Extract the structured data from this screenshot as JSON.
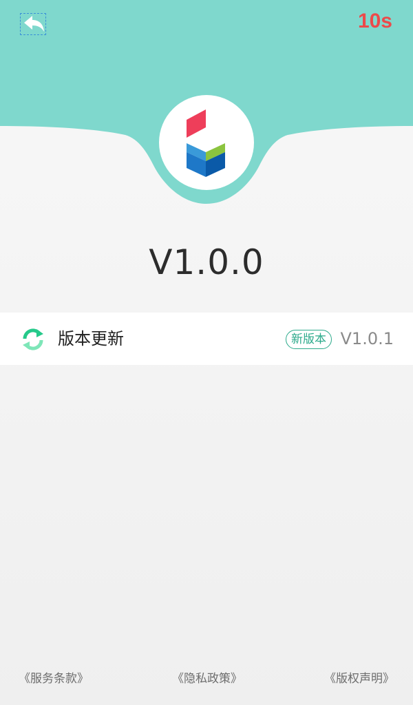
{
  "header": {
    "countdown": "10s",
    "back_icon": "back-arrow-icon",
    "accent_color": "#7fd8cd"
  },
  "app": {
    "logo_icon": "app-logo-icon",
    "current_version": "V1.0.0"
  },
  "update_row": {
    "icon": "refresh-icon",
    "label": "版本更新",
    "badge": "新版本",
    "latest_version": "V1.0.1"
  },
  "footer": {
    "links": [
      {
        "label": "《服务条款》"
      },
      {
        "label": "《隐私政策》"
      },
      {
        "label": "《版权声明》"
      }
    ]
  },
  "colors": {
    "countdown": "#ec4a4a",
    "badge": "#2aa98a",
    "refresh_green": "#25c98a"
  }
}
